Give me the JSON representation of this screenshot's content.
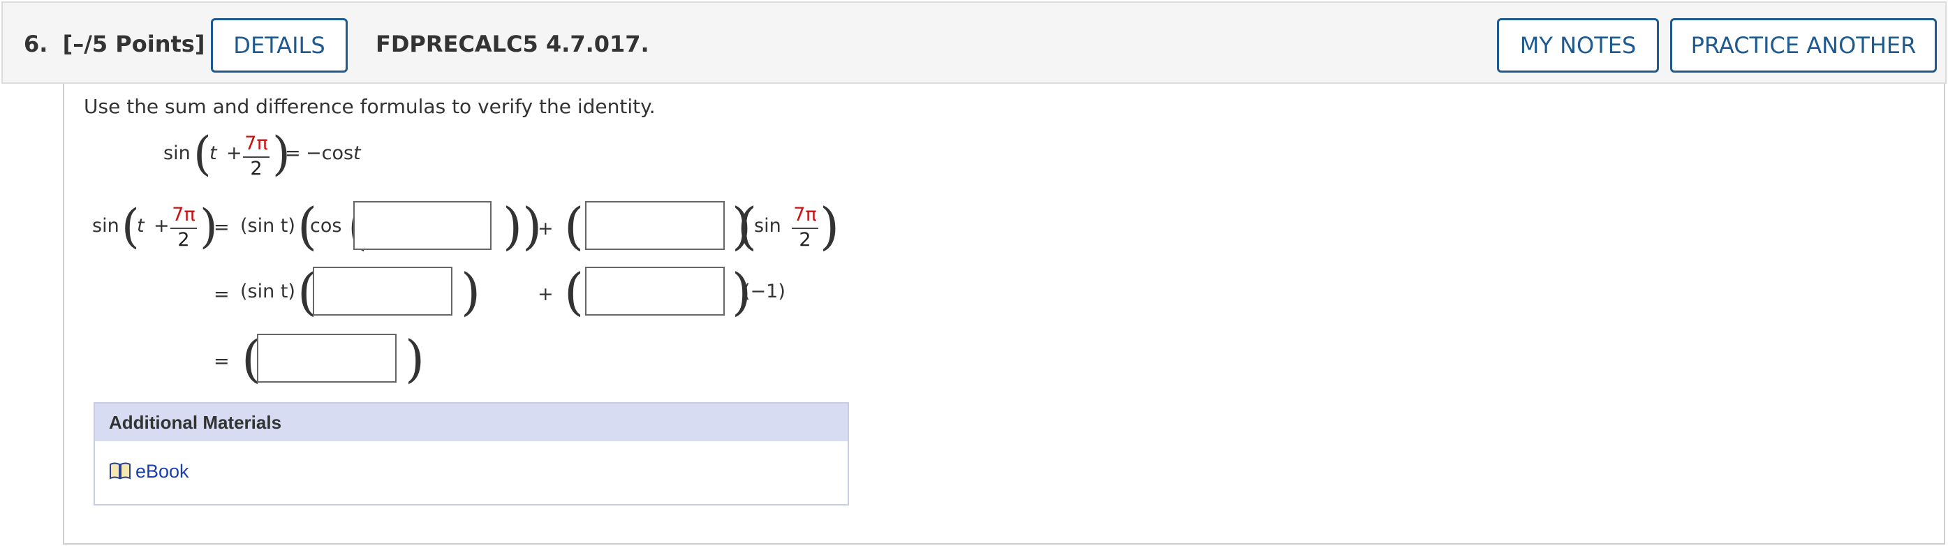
{
  "header": {
    "question_number": "6.",
    "points": "[–/5 Points]",
    "details_label": "DETAILS",
    "question_code": "FDPRECALC5 4.7.017.",
    "my_notes_label": "MY NOTES",
    "practice_another_label": "PRACTICE ANOTHER"
  },
  "problem": {
    "instruction": "Use the sum and difference formulas to verify the identity.",
    "identity": {
      "lhs_func": "sin",
      "var": "t",
      "plus": "+",
      "frac_num": "7π",
      "frac_den": "2",
      "equals": "=",
      "rhs": "−cos",
      "rhs_var": "t"
    },
    "steps": {
      "line1": {
        "lhs_func": "sin",
        "var": "t",
        "plus": "+",
        "frac_num": "7π",
        "frac_den": "2",
        "equals": "=",
        "sin_t": "(sin t)",
        "cos": "cos",
        "plus2": "+",
        "sin": "sin",
        "frac2_num": "7π",
        "frac2_den": "2"
      },
      "line2": {
        "equals": "=",
        "sin_t": "(sin t)",
        "plus": "+",
        "neg_one": "(−1)"
      },
      "line3": {
        "equals": "="
      }
    },
    "answers": {
      "a1": "",
      "a2": "",
      "a3": "",
      "a4": "",
      "a5": ""
    }
  },
  "materials": {
    "title": "Additional Materials",
    "ebook_label": "eBook"
  }
}
